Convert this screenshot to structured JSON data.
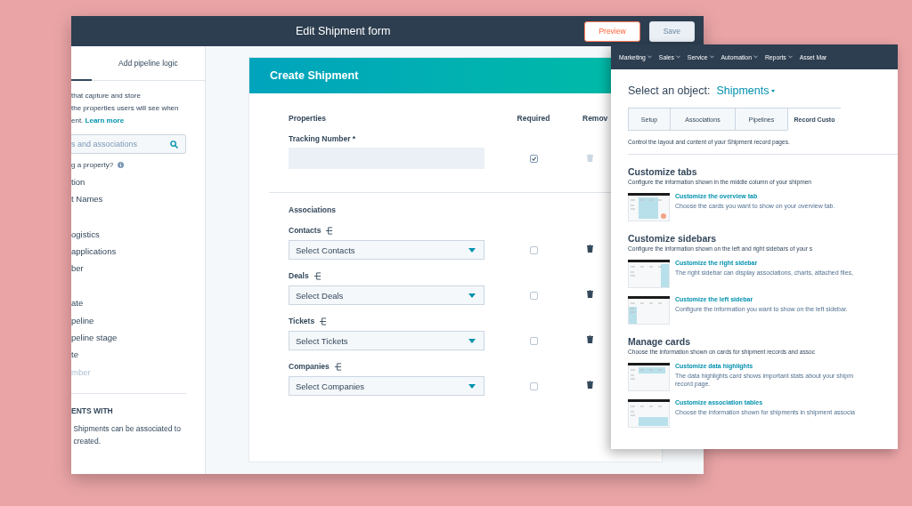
{
  "main_window": {
    "title": "Edit Shipment form",
    "buttons": [
      {
        "label": "Preview",
        "kind": "secondary",
        "disabled": false
      },
      {
        "label": "Save",
        "kind": "primary",
        "disabled": true
      }
    ]
  },
  "sidebar": {
    "tabs": [
      {
        "label": "Add pipeline logic",
        "selected": false
      }
    ],
    "intro": {
      "lines": [
        "that capture and store",
        "the properties users will see when"
      ],
      "last": "ent.",
      "link": "Learn more"
    },
    "search": {
      "placeholder": "s and associations"
    },
    "help": "g a property?",
    "property_groups": [
      {
        "items": [
          {
            "text": "tion",
            "disabled": false
          },
          {
            "text": "t Names",
            "disabled": false
          }
        ]
      },
      {
        "items": [
          {
            "text": "ogistics",
            "disabled": false
          },
          {
            "text": "applications",
            "disabled": false
          },
          {
            "text": "ber",
            "disabled": false
          }
        ]
      },
      {
        "items": [
          {
            "text": "ate",
            "disabled": false
          },
          {
            "text": "peline",
            "disabled": false
          },
          {
            "text": "peline stage",
            "disabled": false
          },
          {
            "text": "te",
            "disabled": false
          },
          {
            "text": "mber",
            "disabled": true
          }
        ]
      }
    ],
    "note": {
      "heading": "ENTS WITH",
      "lines": [
        "Shipments can be associated to",
        "created."
      ]
    }
  },
  "form": {
    "title": "Create Shipment",
    "columns": [
      "Properties",
      "Required",
      "Remov"
    ],
    "properties": [
      {
        "label": "Tracking Number *",
        "required": true,
        "removable": false
      }
    ],
    "associations_heading": "Associations",
    "associations": [
      {
        "label": "Contacts",
        "placeholder": "Select Contacts",
        "required": false,
        "removable": true
      },
      {
        "label": "Deals",
        "placeholder": "Select Deals",
        "required": false,
        "removable": true
      },
      {
        "label": "Tickets",
        "placeholder": "Select Tickets",
        "required": false,
        "removable": true
      },
      {
        "label": "Companies",
        "placeholder": "Select Companies",
        "required": false,
        "removable": true
      }
    ]
  },
  "settings_window": {
    "nav": [
      {
        "label": "Marketing",
        "has_menu": true
      },
      {
        "label": "Sales",
        "has_menu": true
      },
      {
        "label": "Service",
        "has_menu": true
      },
      {
        "label": "Automation",
        "has_menu": true
      },
      {
        "label": "Reports",
        "has_menu": true
      },
      {
        "label": "Asset Mar",
        "has_menu": false
      }
    ],
    "heading": "Select an object:",
    "object": "Shipments",
    "tabs": [
      {
        "label": "Setup",
        "selected": false
      },
      {
        "label": "Associations",
        "selected": false
      },
      {
        "label": "Pipelines",
        "selected": false
      },
      {
        "label": "Record Custo",
        "selected": true
      }
    ],
    "description": "Control the layout and content of your Shipment record pages.",
    "sections": [
      {
        "title": "Customize tabs",
        "description": "Configure the information shown in the middle column of your shipmen",
        "items": [
          {
            "kind": "overview",
            "title": "Customize the overview tab",
            "description": "Choose the cards you want to show on your overview tab."
          }
        ]
      },
      {
        "title": "Customize sidebars",
        "description": "Configure the information shown on the left and right sidebars of your s",
        "items": [
          {
            "kind": "right",
            "title": "Customize the right sidebar",
            "description": "The right sidebar can display associations, charts, attached files,"
          },
          {
            "kind": "left",
            "title": "Customize the left sidebar",
            "description": "Configure the information you want to show on the left sidebar."
          }
        ]
      },
      {
        "title": "Manage cards",
        "description": "Choose the information shown on cards for shipment records and assoc",
        "items": [
          {
            "kind": "top",
            "title": "Customize data highlights",
            "description": "The data highlights card shows important stats about your shipm",
            "extra": "record page."
          },
          {
            "kind": "table",
            "title": "Customize association tables",
            "description": "Choose the information shown for shipments in shipment associa"
          }
        ]
      }
    ]
  }
}
